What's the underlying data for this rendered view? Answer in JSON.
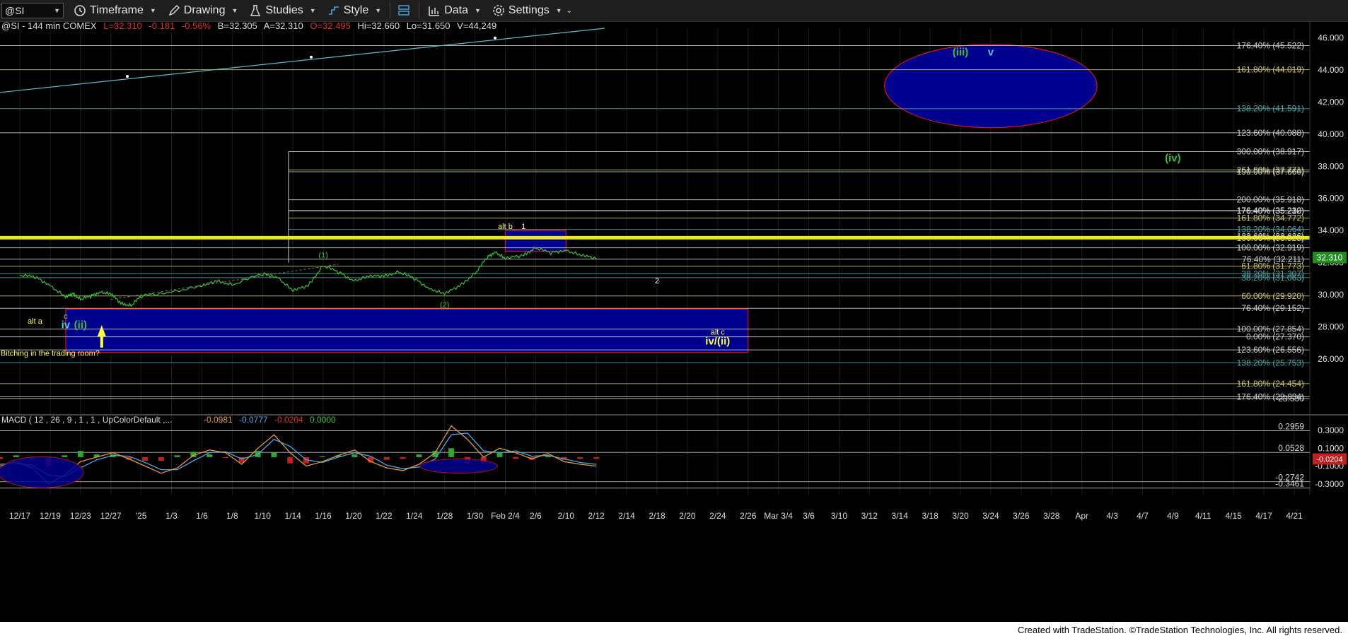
{
  "toolbar": {
    "symbol": "@SI",
    "timeframe": "Timeframe",
    "drawing": "Drawing",
    "studies": "Studies",
    "style": "Style",
    "data": "Data",
    "settings": "Settings"
  },
  "header": {
    "info": "@SI - 144 min  COMEX",
    "last": "L=32.310",
    "change": "-0.181",
    "change_pct": "-0.56%",
    "bid": "B=32.305",
    "ask": "A=32.310",
    "open": "O=32.495",
    "high": "Hi=32.660",
    "low": "Lo=31.650",
    "volume": "V=44,249"
  },
  "footer": "Created with TradeStation. ©TradeStation Technologies, Inc. All rights reserved.",
  "colors": {
    "price": "#36c436",
    "box_fill": "#00008f",
    "box_edge": "#d01515",
    "yellow_line": "#e8e829",
    "fib_white": "#cfcfcf",
    "label_green": "#36c436",
    "label_cyan": "#3fd0e6",
    "label_yellow": "#ffff44",
    "macd_line": "#e59a3a",
    "signal_line": "#4aa7e6",
    "hist_pos": "#2fa62f",
    "hist_neg": "#c02020"
  },
  "chart_data": {
    "type": "line",
    "title": "@SI - 144 min COMEX",
    "ylim": [
      22.6,
      46.6
    ],
    "y_ticks": [
      "46.000",
      "44.000",
      "42.000",
      "40.000",
      "38.000",
      "36.000",
      "34.000",
      "32.000",
      "30.000",
      "28.000",
      "26.000"
    ],
    "x_ticks": [
      "12/17",
      "12/19",
      "12/23",
      "12/27",
      "'25",
      "1/3",
      "1/6",
      "1/8",
      "1/10",
      "1/14",
      "1/16",
      "1/20",
      "1/22",
      "1/24",
      "1/28",
      "1/30",
      "Feb 2/4",
      "2/6",
      "2/10",
      "2/12",
      "2/14",
      "2/18",
      "2/20",
      "2/24",
      "2/26",
      "Mar 3/4",
      "3/6",
      "3/10",
      "3/12",
      "3/14",
      "3/18",
      "3/20",
      "3/24",
      "3/26",
      "3/28",
      "Apr",
      "4/3",
      "4/7",
      "4/9",
      "4/11",
      "4/15",
      "4/17",
      "4/21"
    ],
    "last_price": "32.310",
    "series": [
      {
        "name": "@SI",
        "points": [
          [
            "12/17",
            31.2
          ],
          [
            "12/18",
            31.1
          ],
          [
            "12/19",
            30.6
          ],
          [
            "12/19b",
            29.8
          ],
          [
            "12/20",
            30.1
          ],
          [
            "12/23",
            29.7
          ],
          [
            "12/24",
            29.9
          ],
          [
            "12/26",
            30.2
          ],
          [
            "12/27",
            30.0
          ],
          [
            "12/30",
            29.5
          ],
          [
            "12/31",
            29.3
          ],
          [
            "1/2",
            29.9
          ],
          [
            "1/3",
            30.2
          ],
          [
            "1/6",
            30.5
          ],
          [
            "1/7",
            30.9
          ],
          [
            "1/8",
            30.6
          ],
          [
            "1/10",
            31.3
          ],
          [
            "1/13",
            31.1
          ],
          [
            "1/14",
            30.2
          ],
          [
            "1/15",
            30.6
          ],
          [
            "1/16",
            31.8
          ],
          [
            "1/17",
            31.4
          ],
          [
            "1/20",
            30.9
          ],
          [
            "1/21",
            31.1
          ],
          [
            "1/22",
            31.2
          ],
          [
            "1/23",
            31.4
          ],
          [
            "1/24",
            31.0
          ],
          [
            "1/27",
            30.4
          ],
          [
            "1/28",
            30.0
          ],
          [
            "1/29",
            30.6
          ],
          [
            "1/30",
            31.3
          ],
          [
            "1/31",
            32.3
          ],
          [
            "2/3",
            32.7
          ],
          [
            "2/4",
            32.2
          ],
          [
            "2/5",
            32.5
          ],
          [
            "2/6",
            32.9
          ],
          [
            "2/7",
            32.6
          ],
          [
            "2/10",
            32.8
          ],
          [
            "2/11",
            32.4
          ],
          [
            "2/12",
            32.31
          ]
        ]
      }
    ],
    "fib_levels": [
      {
        "label": "176.40% (45.522)",
        "value": 45.522,
        "color": "#cfcfcf"
      },
      {
        "label": "161.80% (44.019)",
        "value": 44.019,
        "color": "#cfc86a"
      },
      {
        "label": "138.20% (41.591)",
        "value": 41.591,
        "color": "#4fa7a7"
      },
      {
        "label": "123.60% (40.088)",
        "value": 40.088,
        "color": "#cfcfcf"
      },
      {
        "label": "300.00% (38.917)",
        "value": 38.917,
        "color": "#cfcfcf"
      },
      {
        "label": "261.80% (37.771)",
        "value": 37.771,
        "color": "#cfc86a"
      },
      {
        "label": "190.00% (37.660)",
        "value": 37.66,
        "color": "#cfcfcf"
      },
      {
        "label": "200.00% (35.918)",
        "value": 35.918,
        "color": "#cfcfcf"
      },
      {
        "label": "176.40% (35.232)",
        "value": 35.232,
        "color": "#ffffff"
      },
      {
        "label": "176.40% (35.218)",
        "value": 35.218,
        "color": "#cfcfcf"
      },
      {
        "label": "161.80% (34.772)",
        "value": 34.772,
        "color": "#cfc86a"
      },
      {
        "label": "138.20% (34.064)",
        "value": 34.064,
        "color": "#4fa7a7"
      },
      {
        "label": "123.60% (33.626)",
        "value": 33.626,
        "color": "#cfcfcf"
      },
      {
        "label": "100.00% (33.528)",
        "value": 33.528,
        "color": "#cfcfcf"
      },
      {
        "label": "100.00% (32.919)",
        "value": 32.919,
        "color": "#cfcfcf"
      },
      {
        "label": "76.40% (32.211)",
        "value": 32.211,
        "color": "#cfcfcf"
      },
      {
        "label": "61.80% (31.773)",
        "value": 31.773,
        "color": "#cfc86a"
      },
      {
        "label": "38.20% (31.307)",
        "value": 31.307,
        "color": "#4fa7a7"
      },
      {
        "label": "38.20% (31.063)",
        "value": 31.063,
        "color": "#4fa7a7"
      },
      {
        "label": "60.00% (29.920)",
        "value": 29.92,
        "color": "#cfc86a"
      },
      {
        "label": "76.40% (29.152)",
        "value": 29.152,
        "color": "#cfcfcf"
      },
      {
        "label": "100.00% (27.854)",
        "value": 27.854,
        "color": "#cfcfcf"
      },
      {
        "label": "0.00% (27.370)",
        "value": 27.37,
        "color": "#cfcfcf"
      },
      {
        "label": "123.60% (26.556)",
        "value": 26.556,
        "color": "#cfcfcf"
      },
      {
        "label": "138.20% (25.753)",
        "value": 25.753,
        "color": "#4fa7a7"
      },
      {
        "label": "161.80% (24.454)",
        "value": 24.454,
        "color": "#cfc86a"
      },
      {
        "label": "176.40% (23.634)",
        "value": 23.634,
        "color": "#cfcfcf"
      },
      {
        "label": "23.530",
        "value": 23.53,
        "color": "#cfcfcf"
      }
    ],
    "yellow_band": {
      "value": 33.55
    },
    "annotations": [
      {
        "text": "alt a",
        "at": [
          "12/18",
          28.2
        ],
        "color": "#ffff44"
      },
      {
        "text": "c",
        "at": [
          "12/19b",
          28.5
        ],
        "color": "#3fd0e6"
      },
      {
        "text": "iv",
        "at": [
          "12/19b",
          27.9
        ],
        "color": "#3fd0e6"
      },
      {
        "text": "(ii)",
        "at": [
          "12/23",
          27.9
        ],
        "color": "#36c436"
      },
      {
        "text": "Bitching in the trading room?",
        "at": [
          "12/19",
          26.2
        ],
        "color": "#ffff44"
      },
      {
        "text": "(1)",
        "at": [
          "1/16",
          32.3
        ],
        "color": "#36c436"
      },
      {
        "text": "(2)",
        "at": [
          "1/28",
          29.2
        ],
        "color": "#36c436"
      },
      {
        "text": "alt b",
        "at": [
          "2/4",
          34.1
        ],
        "color": "#ffff44"
      },
      {
        "text": "1",
        "at": [
          "2/5",
          34.1
        ],
        "color": "#ffffff"
      },
      {
        "text": "2",
        "at": [
          "2/13",
          30.7
        ],
        "color": "#ffffff"
      },
      {
        "text": "alt c",
        "at": [
          "2/24",
          27.5
        ],
        "color": "#ffff44"
      },
      {
        "text": "iv/(ii)",
        "at": [
          "2/24",
          26.9
        ],
        "color": "#ffff44"
      },
      {
        "text": "(iii)",
        "at": [
          "3/20",
          44.9
        ],
        "color": "#36c436"
      },
      {
        "text": "v",
        "at": [
          "3/24",
          44.9
        ],
        "color": "#3fd0e6"
      },
      {
        "text": "(iv)",
        "at": [
          "4/9",
          38.3
        ],
        "color": "#36c436"
      }
    ],
    "zones": [
      {
        "kind": "rect",
        "from": [
          "12/19b",
          26.4
        ],
        "to": [
          "2/26",
          29.1
        ]
      },
      {
        "kind": "rect",
        "from": [
          "2/4",
          32.7
        ],
        "to": [
          "2/10",
          34.0
        ]
      },
      {
        "kind": "ellipse",
        "center": [
          "3/24",
          43.0
        ],
        "rx_days": 14,
        "ry_value": 2.6
      }
    ],
    "macd": {
      "title": "MACD ( 12 , 26 , 9 , 1 , 1 , UpColorDefault ,...",
      "values": [
        "-0.0981",
        "-0.0777",
        "-0.0204",
        "0.0000"
      ],
      "ylim": [
        -0.42,
        0.45
      ],
      "ref_levels": [
        {
          "label": "0.2959",
          "value": 0.2959
        },
        {
          "label": "0.0528",
          "value": 0.0528
        },
        {
          "label": "-0.2742",
          "value": -0.2742
        },
        {
          "label": "-0.3461",
          "value": -0.3461
        }
      ],
      "y_ticks": [
        "0.3000",
        "0.1000",
        "-0.1000",
        "-0.3000"
      ],
      "last_value": "-0.0204",
      "macd_line": [
        -0.1,
        -0.05,
        -0.12,
        -0.3,
        -0.2,
        -0.05,
        0.0,
        0.05,
        -0.02,
        -0.1,
        -0.18,
        -0.12,
        0.02,
        0.08,
        0.05,
        -0.08,
        0.1,
        0.25,
        0.05,
        -0.1,
        -0.05,
        0.02,
        0.08,
        -0.05,
        -0.12,
        -0.15,
        -0.08,
        0.05,
        0.35,
        0.2,
        0.0,
        0.1,
        0.05,
        -0.02,
        0.04,
        -0.05,
        -0.08,
        -0.1
      ],
      "signal_line": [
        -0.08,
        -0.07,
        -0.09,
        -0.2,
        -0.22,
        -0.12,
        -0.03,
        0.02,
        0.01,
        -0.06,
        -0.14,
        -0.14,
        -0.04,
        0.05,
        0.06,
        -0.02,
        0.03,
        0.2,
        0.12,
        -0.03,
        -0.06,
        0.0,
        0.05,
        0.01,
        -0.09,
        -0.13,
        -0.11,
        -0.02,
        0.25,
        0.27,
        0.07,
        0.05,
        0.07,
        0.01,
        0.02,
        -0.02,
        -0.06,
        -0.08
      ]
    }
  }
}
